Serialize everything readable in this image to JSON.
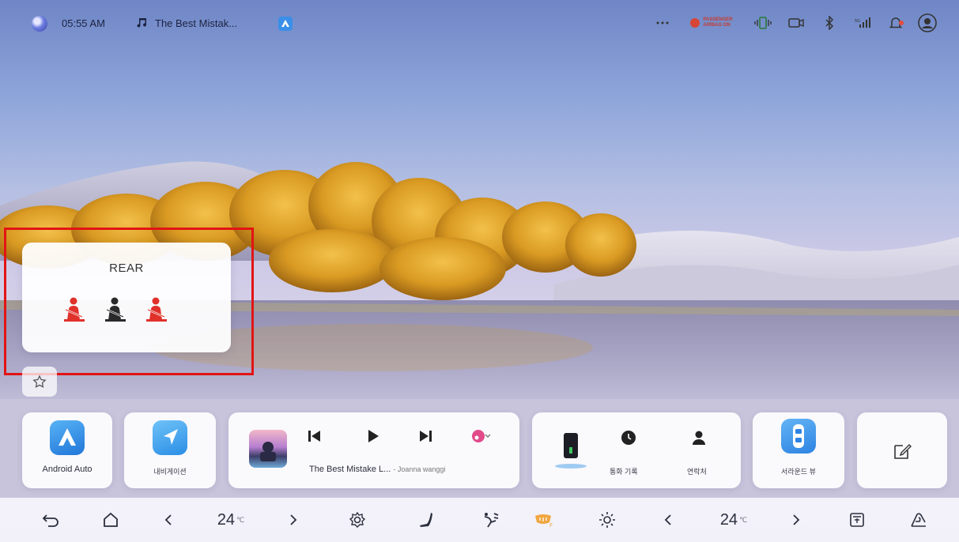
{
  "status_bar": {
    "time": "05:55 AM",
    "now_playing": "The Best Mistak...",
    "airbag_line1": "PASSENGER",
    "airbag_line2": "AIRBAG ON",
    "colors": {
      "airbag": "#d64535",
      "notification_dot": "#e64b3c"
    },
    "icons": [
      "user-orb-icon",
      "music-note-icon",
      "android-auto-mini-icon",
      "more-icon",
      "airbag-icon",
      "phone-vibrate-icon",
      "camera-icon",
      "bluetooth-icon",
      "signal-icon",
      "bell-icon",
      "profile-icon"
    ]
  },
  "seatbelt_card": {
    "title": "REAR",
    "seats": [
      {
        "position": "left",
        "status": "unbuckled",
        "color": "#e0312b"
      },
      {
        "position": "center",
        "status": "buckled",
        "color": "#2a2a2a"
      },
      {
        "position": "right",
        "status": "unbuckled",
        "color": "#e0312b"
      }
    ],
    "highlight_color": "#e21414"
  },
  "dock": {
    "android_auto": {
      "label": "Android Auto",
      "color": "#2f8ee8"
    },
    "navigation": {
      "label": "내비게이션",
      "color": "#3aa0f0"
    },
    "media": {
      "track": "The Best Mistake L...",
      "artist": "- Joanna wanggi",
      "controls": [
        "previous-icon",
        "play-icon",
        "next-icon",
        "source-icon"
      ]
    },
    "phone": {
      "recent_label": "통화 기록",
      "contacts_label": "연락처"
    },
    "surround": {
      "label": "서라운드 뷰",
      "color": "#3b8fe6"
    },
    "edit_icon": "edit-icon"
  },
  "bottom_bar": {
    "left_temp": "24",
    "right_temp": "24",
    "temp_unit": "℃",
    "icons": [
      "back-icon",
      "home-icon",
      "chevron-left-icon",
      "chevron-right-icon",
      "gear-icon",
      "seat-icon",
      "fan-direction-icon",
      "heated-front-icon",
      "sun-icon",
      "chevron-left-icon",
      "chevron-right-icon",
      "defrost-icon",
      "recirculation-icon"
    ]
  }
}
